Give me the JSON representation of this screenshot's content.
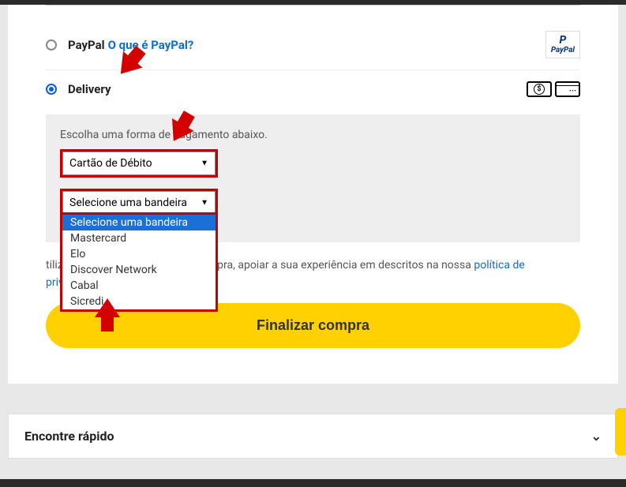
{
  "payment_options": {
    "paypal": {
      "label": "PayPal",
      "help_link": "O que é PayPal?",
      "logo_text": "PayPal"
    },
    "delivery": {
      "label": "Delivery"
    }
  },
  "delivery_panel": {
    "instruction": "Escolha uma forma de pagamento abaixo.",
    "payment_type_select": {
      "value": "Cartão de Débito"
    },
    "flag_select": {
      "placeholder": "Selecione uma bandeira",
      "options": [
        "Selecione uma bandeira",
        "Mastercard",
        "Elo",
        "Discover Network",
        "Cabal",
        "Sicredi"
      ]
    }
  },
  "disclosure": {
    "text_before": "tilizados para processar a sua compra, apoiar a sua experiência em descritos na nossa ",
    "link": "política de privacidade",
    "text_after": "."
  },
  "finalize_button": "Finalizar compra",
  "find_fast": {
    "title": "Encontre rápido"
  }
}
